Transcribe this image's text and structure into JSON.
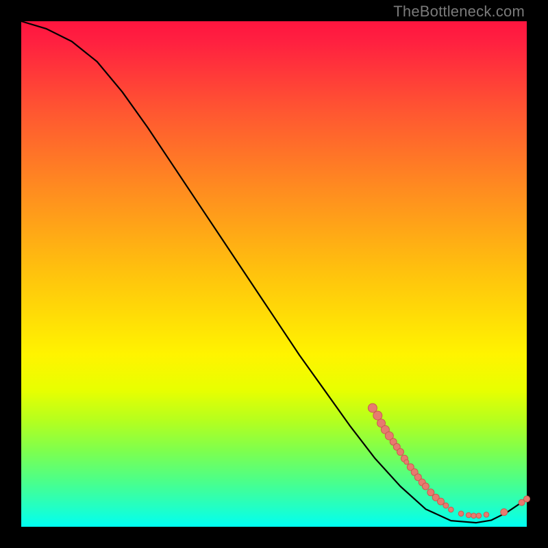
{
  "watermark": "TheBottleneck.com",
  "colors": {
    "point_fill": "#e77a6f",
    "point_stroke": "#c95a50",
    "curve": "#000000"
  },
  "chart_data": {
    "type": "line",
    "title": "",
    "xlabel": "",
    "ylabel": "",
    "xlim": [
      0,
      100
    ],
    "ylim": [
      0,
      100
    ],
    "curve": [
      {
        "x": 0,
        "y": 100
      },
      {
        "x": 5,
        "y": 98.5
      },
      {
        "x": 10,
        "y": 96
      },
      {
        "x": 15,
        "y": 92
      },
      {
        "x": 20,
        "y": 86
      },
      {
        "x": 25,
        "y": 79
      },
      {
        "x": 30,
        "y": 71.5
      },
      {
        "x": 35,
        "y": 64
      },
      {
        "x": 40,
        "y": 56.5
      },
      {
        "x": 45,
        "y": 49
      },
      {
        "x": 50,
        "y": 41.5
      },
      {
        "x": 55,
        "y": 34
      },
      {
        "x": 60,
        "y": 27
      },
      {
        "x": 65,
        "y": 20
      },
      {
        "x": 70,
        "y": 13.5
      },
      {
        "x": 75,
        "y": 8
      },
      {
        "x": 80,
        "y": 3.5
      },
      {
        "x": 85,
        "y": 1.2
      },
      {
        "x": 90,
        "y": 0.8
      },
      {
        "x": 93,
        "y": 1.3
      },
      {
        "x": 96,
        "y": 2.8
      },
      {
        "x": 100,
        "y": 5.5
      }
    ],
    "points": [
      {
        "x": 69.5,
        "y": 23.5,
        "r": 6.5
      },
      {
        "x": 70.5,
        "y": 22.0,
        "r": 6.5
      },
      {
        "x": 71.2,
        "y": 20.5,
        "r": 6.0
      },
      {
        "x": 72.0,
        "y": 19.2,
        "r": 6.0
      },
      {
        "x": 72.8,
        "y": 18.0,
        "r": 6.0
      },
      {
        "x": 73.6,
        "y": 16.8,
        "r": 5.0
      },
      {
        "x": 74.3,
        "y": 15.8,
        "r": 5.0
      },
      {
        "x": 75.0,
        "y": 14.8,
        "r": 5.0
      },
      {
        "x": 75.8,
        "y": 13.5,
        "r": 5.0
      },
      {
        "x": 76.2,
        "y": 12.8,
        "r": 3.5
      },
      {
        "x": 77.0,
        "y": 11.8,
        "r": 5.0
      },
      {
        "x": 77.8,
        "y": 10.8,
        "r": 5.0
      },
      {
        "x": 78.5,
        "y": 9.8,
        "r": 5.0
      },
      {
        "x": 79.3,
        "y": 8.8,
        "r": 5.0
      },
      {
        "x": 80.0,
        "y": 8.0,
        "r": 5.0
      },
      {
        "x": 81.0,
        "y": 6.8,
        "r": 5.0
      },
      {
        "x": 82.0,
        "y": 5.8,
        "r": 5.0
      },
      {
        "x": 83.0,
        "y": 5.0,
        "r": 5.0
      },
      {
        "x": 84.0,
        "y": 4.2,
        "r": 4.0
      },
      {
        "x": 85.0,
        "y": 3.4,
        "r": 3.8
      },
      {
        "x": 87.0,
        "y": 2.6,
        "r": 3.8
      },
      {
        "x": 88.5,
        "y": 2.3,
        "r": 3.8
      },
      {
        "x": 89.5,
        "y": 2.2,
        "r": 3.8
      },
      {
        "x": 90.5,
        "y": 2.2,
        "r": 3.8
      },
      {
        "x": 92.0,
        "y": 2.4,
        "r": 3.8
      },
      {
        "x": 95.5,
        "y": 2.9,
        "r": 5.0
      },
      {
        "x": 99.0,
        "y": 4.8,
        "r": 4.5
      },
      {
        "x": 100.0,
        "y": 5.5,
        "r": 4.5
      }
    ]
  }
}
